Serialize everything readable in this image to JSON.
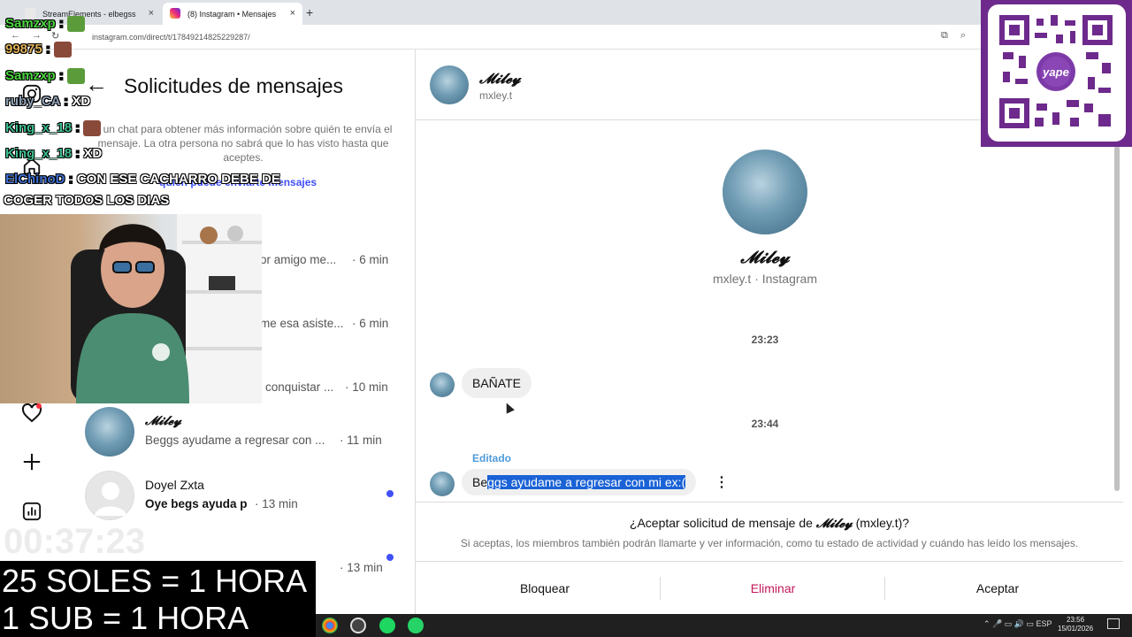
{
  "browser": {
    "tabs": [
      {
        "title": "StreamElements - elbegss",
        "close": "×"
      },
      {
        "title": "(8) Instagram • Mensajes",
        "close": "×"
      }
    ],
    "new_tab": "+",
    "url": "instagram.com/direct/t/17849214825229287/"
  },
  "requests": {
    "title": "Solicitudes de mensajes",
    "back": "←",
    "info": "e un chat para obtener más información sobre quién te envía el mensaje. La otra persona no sabrá que lo has visto hasta que aceptes.",
    "link": "quién puede enviarte mensajes",
    "items": [
      {
        "preview": "or amigo me...",
        "time": "· 6 min"
      },
      {
        "preview": "me esa asiste...",
        "time": "· 6 min"
      },
      {
        "preview": "conquistar ...",
        "time": "· 10 min"
      },
      {
        "name": "𝓜𝓲𝓵𝓮𝔂",
        "preview": "Beggs ayudame a regresar con ...",
        "time": "· 11 min"
      },
      {
        "name": "Doyel Zxta",
        "preview": "Oye begs ayuda p",
        "time": "· 13 min"
      },
      {
        "time": "· 13 min"
      }
    ]
  },
  "conversation": {
    "header_name": "𝓜𝓲𝓵𝓮𝔂",
    "header_user": "mxley.t",
    "profile_name": "𝓜𝓲𝓵𝓮𝔂",
    "profile_sub": "mxley.t · Instagram",
    "time1": "23:23",
    "msg1": "BAÑATE",
    "time2": "23:44",
    "edited": "Editado",
    "msg2_start": "Be",
    "msg2_selected": "ggs ayudame a regresar con mi ex:(",
    "more": "⋮"
  },
  "accept": {
    "question_prefix": "¿Aceptar solicitud de mensaje de ",
    "question_name": "𝓜𝓲𝓵𝓮𝔂",
    "question_suffix": " (mxley.t)?",
    "note": "Si aceptas, los miembros también podrán llamarte y ver información, como tu estado de actividad y cuándo has leído los mensajes.",
    "block": "Bloquear",
    "delete": "Eliminar",
    "accept": "Aceptar"
  },
  "overlay": {
    "chat": [
      {
        "user": "Samzxp",
        "msg": "",
        "color": "#4cd63f"
      },
      {
        "user": "99875",
        "msg": "",
        "color": "#e0b25a"
      },
      {
        "user": "Samzxp",
        "msg": "",
        "color": "#4cd63f"
      },
      {
        "user": "ruby_CA",
        "msg": "XD",
        "color": "#8fa0b4"
      },
      {
        "user": "King_x_18",
        "msg": "",
        "color": "#3fbf8f"
      },
      {
        "user": "King_x_18",
        "msg": "XD",
        "color": "#3fbf8f"
      },
      {
        "user": "ElChinoD",
        "msg": "CON ESE CACHARRO DEBE DE",
        "color": "#3f6fcf"
      },
      {
        "user": "",
        "msg": "COGER TODOS LOS DIAS",
        "color": "#ffffff"
      }
    ],
    "timer": "00:37:23",
    "promo1": "25 SOLES = 1 HORA",
    "promo2": "1 SUB = 1 HORA",
    "qr_caption": "yape"
  },
  "taskbar": {
    "lang": "ESP",
    "time": "23:56",
    "date": "15/01/2026"
  }
}
